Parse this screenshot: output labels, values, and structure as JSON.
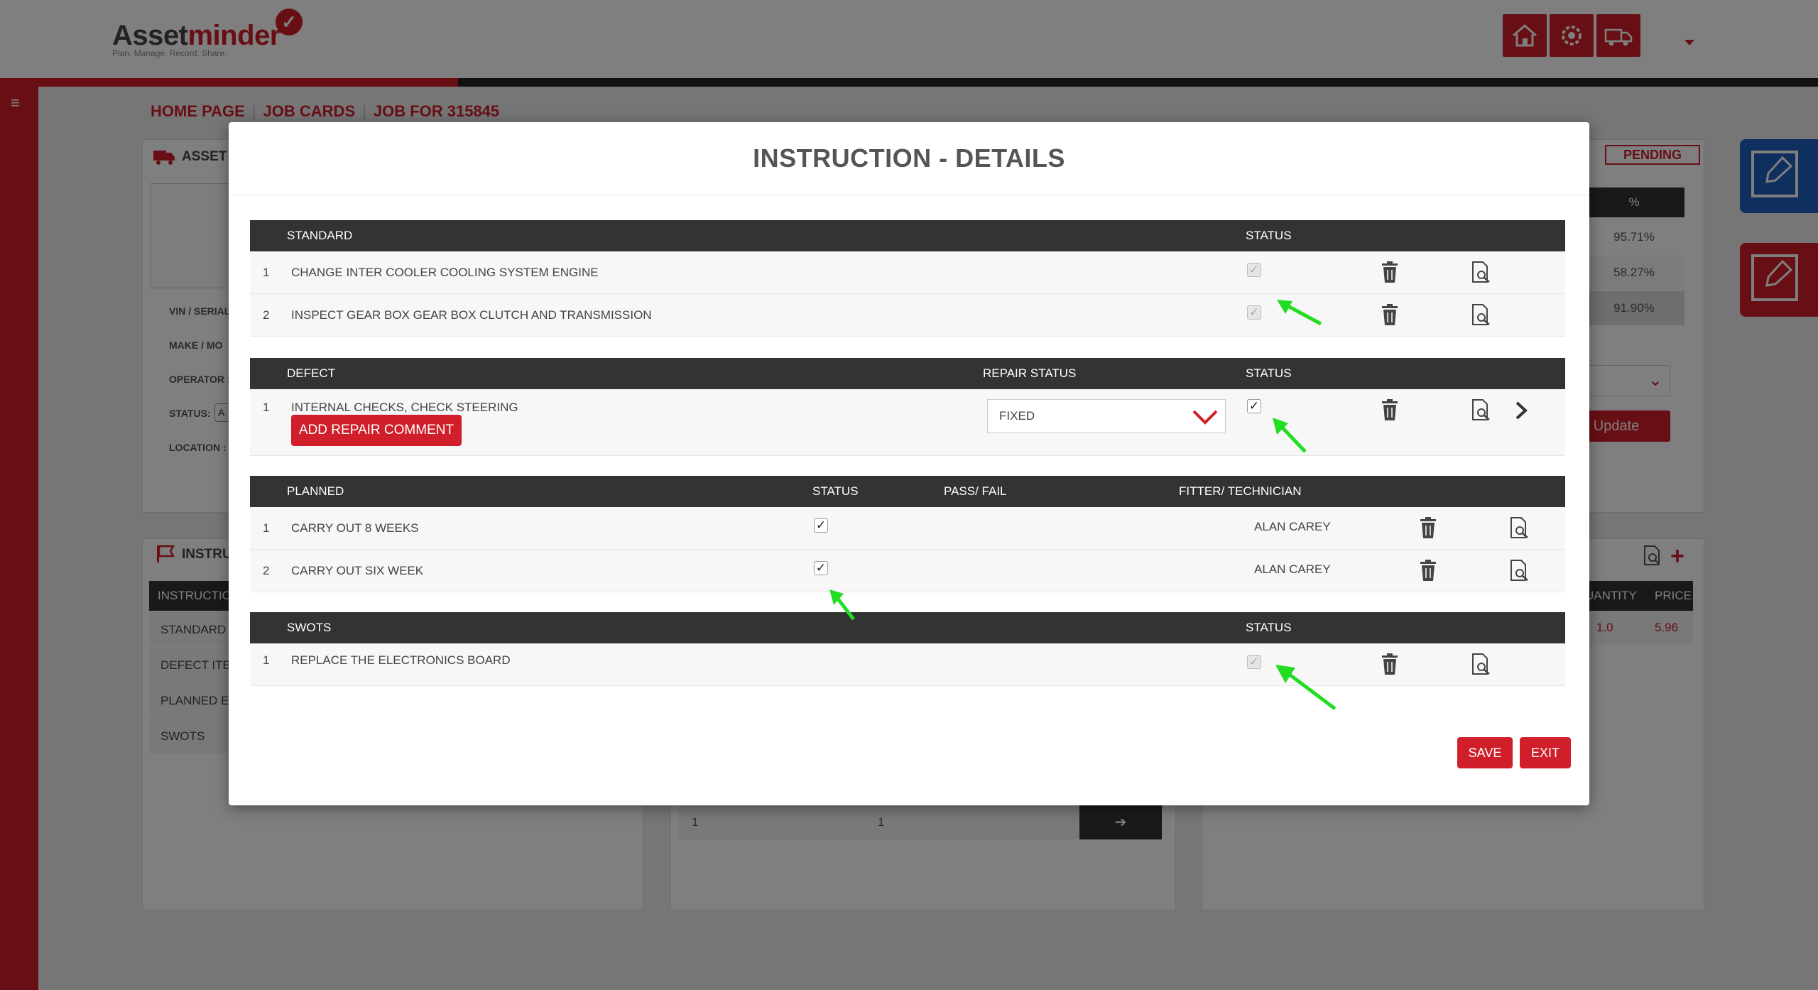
{
  "app": {
    "logo_prefix": "Asset",
    "logo_suffix": "minder",
    "logo_tagline": "Plan. Manage. Record. Share."
  },
  "breadcrumb": {
    "home": "HOME PAGE",
    "job_cards": "JOB CARDS",
    "job": "JOB FOR 315845"
  },
  "background": {
    "asset_title": "ASSET I",
    "asset_labels": [
      "VIN / SERIAL",
      "MAKE / MO",
      "OPERATOR :",
      "STATUS:",
      "LOCATION :"
    ],
    "status_value_initial": "A",
    "status_chip": "PENDING",
    "pct_header": "%",
    "pct_values": [
      "95.71%",
      "58.27%",
      "91.90%"
    ],
    "update_label": "Update",
    "instr_title": "INSTRU",
    "instr_list_header": "INSTRUCTIO",
    "instr_list_items": [
      "STANDARD",
      "DEFECT ITEM",
      "PLANNED E",
      "SWOTS"
    ],
    "pager_left": "1",
    "pager_right": "1",
    "pager_arrow": "➔",
    "parts_headers": [
      "UANTITY",
      "PRICE"
    ],
    "parts_row": [
      "1.0",
      "5.96"
    ]
  },
  "modal": {
    "title": "INSTRUCTION - DETAILS",
    "standard": {
      "header": "STANDARD",
      "status_header": "STATUS",
      "rows": [
        {
          "num": "1",
          "text": "CHANGE INTER COOLER COOLING SYSTEM ENGINE"
        },
        {
          "num": "2",
          "text": "INSPECT GEAR BOX GEAR BOX CLUTCH AND TRANSMISSION"
        }
      ]
    },
    "defect": {
      "header": "DEFECT",
      "repair_status_header": "REPAIR STATUS",
      "status_header": "STATUS",
      "rows": [
        {
          "num": "1",
          "text": "INTERNAL CHECKS, CHECK STEERING",
          "repair_status": "FIXED",
          "button": "ADD REPAIR COMMENT"
        }
      ]
    },
    "planned": {
      "header": "PLANNED",
      "status_header": "STATUS",
      "pass_fail_header": "PASS/ FAIL",
      "fitter_header": "FITTER/ TECHNICIAN",
      "rows": [
        {
          "num": "1",
          "text": "CARRY OUT 8 WEEKS",
          "fitter": "ALAN CAREY"
        },
        {
          "num": "2",
          "text": "CARRY OUT SIX WEEK",
          "fitter": "ALAN CAREY"
        }
      ]
    },
    "swots": {
      "header": "SWOTS",
      "status_header": "STATUS",
      "rows": [
        {
          "num": "1",
          "text": "REPLACE THE ELECTRONICS BOARD"
        }
      ]
    },
    "save_label": "SAVE",
    "exit_label": "EXIT"
  },
  "colors": {
    "brand_red": "#d01f2a",
    "header_dark": "#333333",
    "annotation_green": "#22dd22"
  }
}
